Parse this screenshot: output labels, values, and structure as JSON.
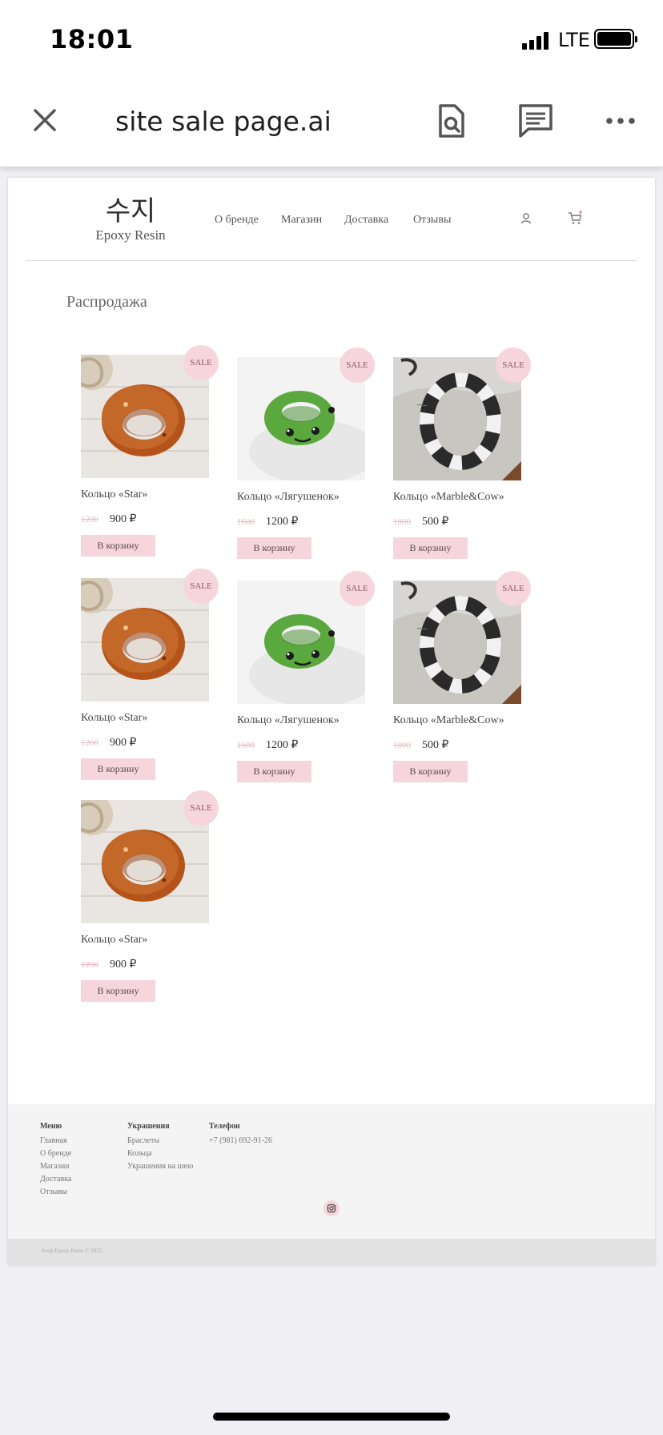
{
  "status_bar": {
    "time": "18:01",
    "network": "LTE",
    "battery_level": 1.0
  },
  "viewer": {
    "title": "site sale page.ai"
  },
  "site": {
    "logo_hangul": "수지",
    "logo_sub": "Epoxy Resin",
    "nav": [
      "О бренде",
      "Магазин",
      "Доставка",
      "Отзывы"
    ],
    "section_title": "Распродажа",
    "sale_badge": "SALE",
    "cart_button": "В корзину",
    "products": [
      {
        "name": "Кольцо «Star»",
        "old_price": "1200",
        "price": "900 ₽",
        "image": "amber-ring"
      },
      {
        "name": "Кольцо «Лягушенок»",
        "old_price": "1600",
        "price": "1200 ₽",
        "image": "frog-ring"
      },
      {
        "name": "Кольцо «Marble&Cow»",
        "old_price": "1000",
        "price": "500 ₽",
        "image": "marble-ring"
      },
      {
        "name": "Кольцо «Star»",
        "old_price": "1200",
        "price": "900 ₽",
        "image": "amber-ring"
      },
      {
        "name": "Кольцо «Лягушенок»",
        "old_price": "1600",
        "price": "1200 ₽",
        "image": "frog-ring"
      },
      {
        "name": "Кольцо «Marble&Cow»",
        "old_price": "1000",
        "price": "500 ₽",
        "image": "marble-ring"
      },
      {
        "name": "Кольцо «Star»",
        "old_price": "1200",
        "price": "900 ₽",
        "image": "amber-ring"
      }
    ]
  },
  "footer": {
    "menu": {
      "title": "Меню",
      "items": [
        "Главная",
        "О бренде",
        "Магазин",
        "Доставка",
        "Отзывы"
      ]
    },
    "jewelry": {
      "title": "Украшения",
      "items": [
        "Браслеты",
        "Кольца",
        "Украшения на шею"
      ]
    },
    "phone": {
      "title": "Телефон",
      "value": "+7 (981) 692-91-26"
    },
    "copyright": "Sooji Epoxy Resin © 2022"
  },
  "colors": {
    "accent_pink": "#f6d5dc",
    "amber": "#b4541a",
    "frog_green": "#5aa83e"
  }
}
